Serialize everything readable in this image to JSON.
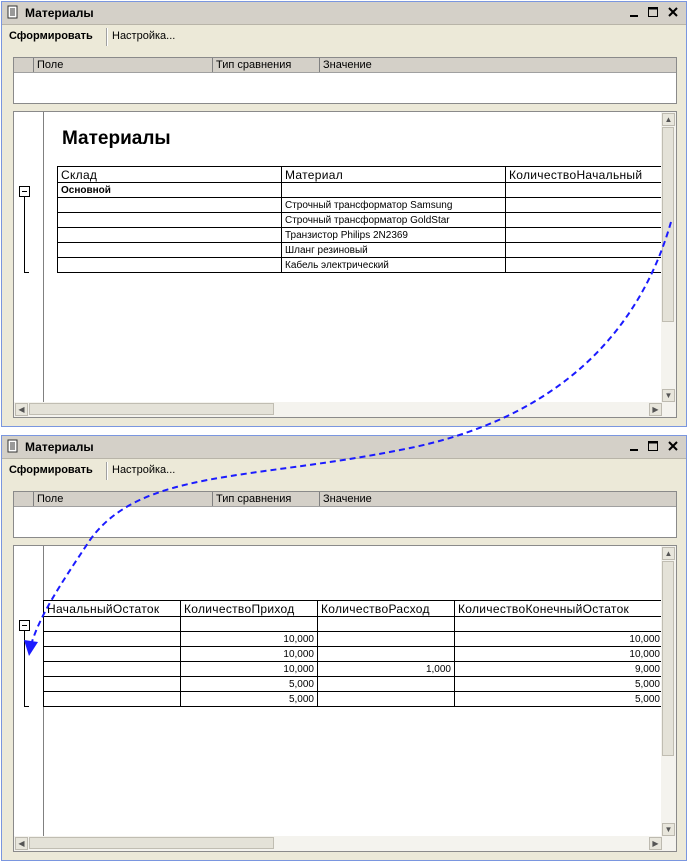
{
  "window_title": "Материалы",
  "toolbar": {
    "generate": "Сформировать",
    "settings": "Настройка..."
  },
  "filter_columns": [
    "Поле",
    "Тип сравнения",
    "Значение"
  ],
  "report_title": "Материалы",
  "columns": [
    "Склад",
    "Материал",
    "КоличествоНачальный",
    "НачальныйОстаток",
    "КоличествоПриход",
    "КоличествоРасход",
    "КоличествоКонечныйОстаток"
  ],
  "group_row": "Основной",
  "rows": [
    {
      "material": "Строчный трансформатор Samsung",
      "prihod": "10,000",
      "rashod": "",
      "konech": "10,000"
    },
    {
      "material": "Строчный трансформатор GoldStar",
      "prihod": "10,000",
      "rashod": "",
      "konech": "10,000"
    },
    {
      "material": "Транзистор Philips 2N2369",
      "prihod": "10,000",
      "rashod": "1,000",
      "konech": "9,000"
    },
    {
      "material": "Шланг резиновый",
      "prihod": "5,000",
      "rashod": "",
      "konech": "5,000"
    },
    {
      "material": "Кабель электрический",
      "prihod": "5,000",
      "rashod": "",
      "konech": "5,000"
    }
  ],
  "colors": {
    "arrow": "#1b1bff",
    "window_bg": "#ece9d8"
  }
}
